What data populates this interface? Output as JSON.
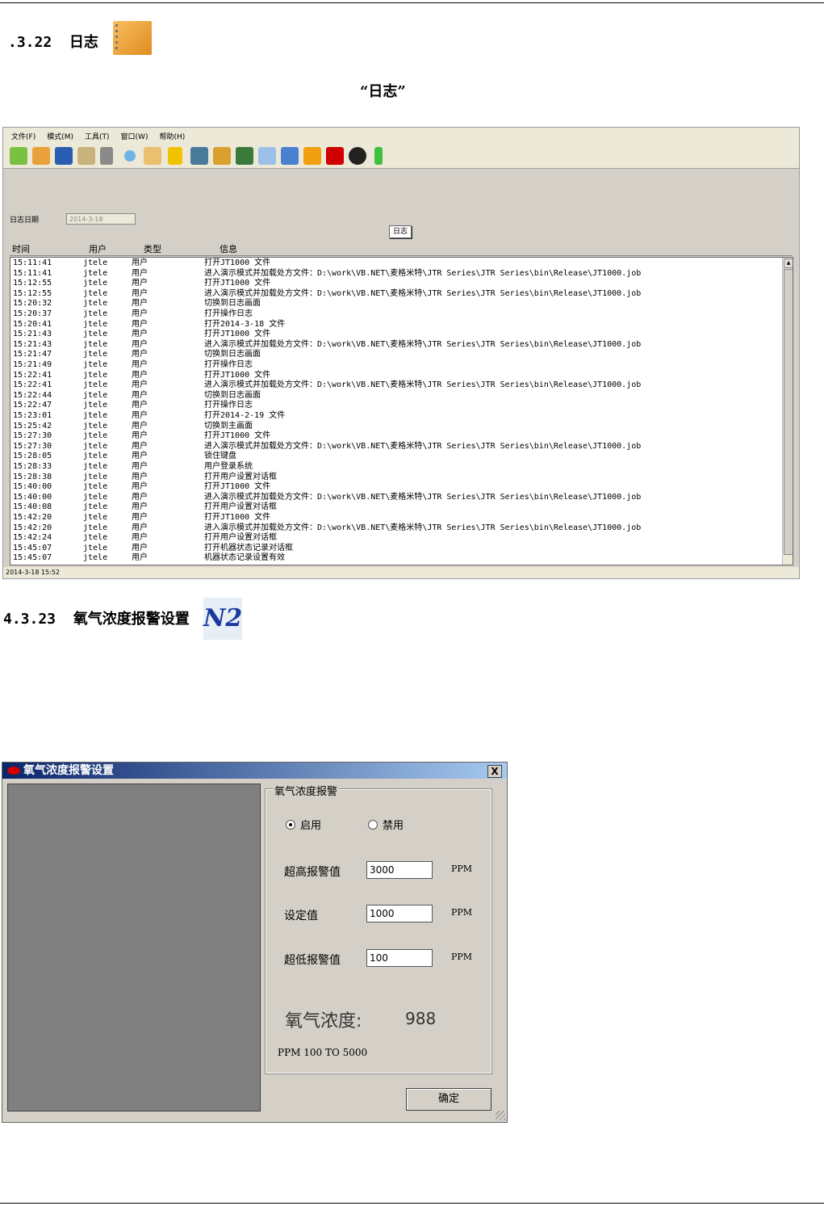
{
  "section1": {
    "number": ".3.22",
    "title": "日志",
    "icon": "notebook-icon"
  },
  "caption1": "“日志”",
  "logwin": {
    "menu": [
      "文件(F)",
      "模式(M)",
      "工具(T)",
      "窗口(W)",
      "帮助(H)"
    ],
    "date_label": "日志日期",
    "date_value": "2014-3-18",
    "log_button": "日志",
    "columns": [
      "时间",
      "用户",
      "类型",
      "信息"
    ],
    "rows": [
      [
        "15:11:41",
        "jtele",
        "用户",
        "打开JT1000 文件"
      ],
      [
        "15:11:41",
        "jtele",
        "用户",
        "进入演示模式并加载处方文件：D:\\work\\VB.NET\\麦格米特\\JTR Series\\JTR Series\\bin\\Release\\JT1000.job"
      ],
      [
        "15:12:55",
        "jtele",
        "用户",
        "打开JT1000 文件"
      ],
      [
        "15:12:55",
        "jtele",
        "用户",
        "进入演示模式并加载处方文件：D:\\work\\VB.NET\\麦格米特\\JTR Series\\JTR Series\\bin\\Release\\JT1000.job"
      ],
      [
        "15:20:32",
        "jtele",
        "用户",
        "切换到日志画面"
      ],
      [
        "15:20:37",
        "jtele",
        "用户",
        "打开操作日志"
      ],
      [
        "15:20:41",
        "jtele",
        "用户",
        "打开2014-3-18 文件"
      ],
      [
        "15:21:43",
        "jtele",
        "用户",
        "打开JT1000 文件"
      ],
      [
        "15:21:43",
        "jtele",
        "用户",
        "进入演示模式并加载处方文件：D:\\work\\VB.NET\\麦格米特\\JTR Series\\JTR Series\\bin\\Release\\JT1000.job"
      ],
      [
        "15:21:47",
        "jtele",
        "用户",
        "切换到日志画面"
      ],
      [
        "15:21:49",
        "jtele",
        "用户",
        "打开操作日志"
      ],
      [
        "15:22:41",
        "jtele",
        "用户",
        "打开JT1000 文件"
      ],
      [
        "15:22:41",
        "jtele",
        "用户",
        "进入演示模式并加载处方文件：D:\\work\\VB.NET\\麦格米特\\JTR Series\\JTR Series\\bin\\Release\\JT1000.job"
      ],
      [
        "15:22:44",
        "jtele",
        "用户",
        "切换到日志画面"
      ],
      [
        "15:22:47",
        "jtele",
        "用户",
        "打开操作日志"
      ],
      [
        "15:23:01",
        "jtele",
        "用户",
        "打开2014-2-19 文件"
      ],
      [
        "15:25:42",
        "jtele",
        "用户",
        "切换到主画面"
      ],
      [
        "15:27:30",
        "jtele",
        "用户",
        "打开JT1000 文件"
      ],
      [
        "15:27:30",
        "jtele",
        "用户",
        "进入演示模式并加载处方文件：D:\\work\\VB.NET\\麦格米特\\JTR Series\\JTR Series\\bin\\Release\\JT1000.job"
      ],
      [
        "15:28:05",
        "jtele",
        "用户",
        "锁住键盘"
      ],
      [
        "15:28:33",
        "jtele",
        "用户",
        "用户登录系统"
      ],
      [
        "15:28:38",
        "jtele",
        "用户",
        "打开用户设置对话框"
      ],
      [
        "15:40:00",
        "jtele",
        "用户",
        "打开JT1000 文件"
      ],
      [
        "15:40:00",
        "jtele",
        "用户",
        "进入演示模式并加载处方文件：D:\\work\\VB.NET\\麦格米特\\JTR Series\\JTR Series\\bin\\Release\\JT1000.job"
      ],
      [
        "15:40:08",
        "jtele",
        "用户",
        "打开用户设置对话框"
      ],
      [
        "15:42:20",
        "jtele",
        "用户",
        "打开JT1000 文件"
      ],
      [
        "15:42:20",
        "jtele",
        "用户",
        "进入演示模式并加载处方文件：D:\\work\\VB.NET\\麦格米特\\JTR Series\\JTR Series\\bin\\Release\\JT1000.job"
      ],
      [
        "15:42:24",
        "jtele",
        "用户",
        "打开用户设置对话框"
      ],
      [
        "15:45:07",
        "jtele",
        "用户",
        "打开机器状态记录对话框"
      ],
      [
        "15:45:07",
        "jtele",
        "用户",
        "机器状态记录设置有效"
      ]
    ],
    "status": "2014-3-18 15:52"
  },
  "section2": {
    "number": "4.3.23",
    "title": "氧气浓度报警设置",
    "icon_text": "N2"
  },
  "dialog": {
    "title": "氧气浓度报警设置",
    "close": "X",
    "group_label": "氧气浓度报警",
    "enable": "启用",
    "disable": "禁用",
    "high_label": "超高报警值",
    "high_value": "3000",
    "set_label": "设定值",
    "set_value": "1000",
    "low_label": "超低报警值",
    "low_value": "100",
    "unit": "PPM",
    "o2_label": "氧气浓度:",
    "o2_value": "988",
    "range": "PPM 100 TO 5000",
    "ok": "确定"
  }
}
